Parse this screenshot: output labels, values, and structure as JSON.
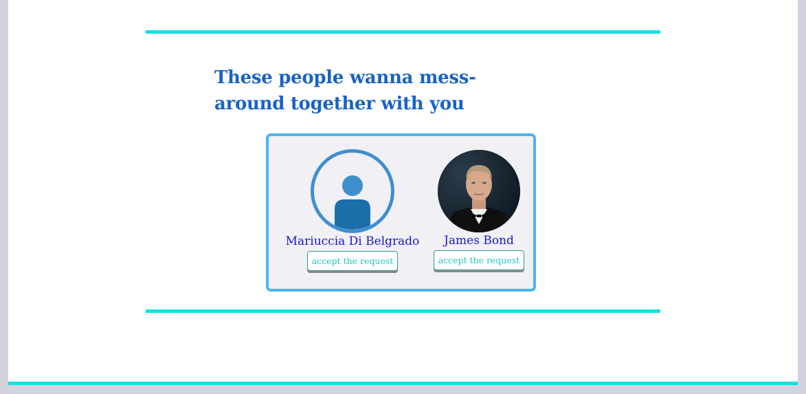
{
  "heading": "These people wanna mess-around together with you",
  "requests": [
    {
      "name": "Mariuccia Di Belgrado",
      "avatar": "default-user-icon",
      "button_label": "accept the request"
    },
    {
      "name": "James Bond",
      "avatar": "profile-photo",
      "button_label": "accept the request"
    }
  ],
  "colors": {
    "rule": "#16e0e0",
    "heading": "#1863c4",
    "card_border": "#4db3f0",
    "name": "#1a16c8",
    "button_text": "#20c4c4"
  }
}
